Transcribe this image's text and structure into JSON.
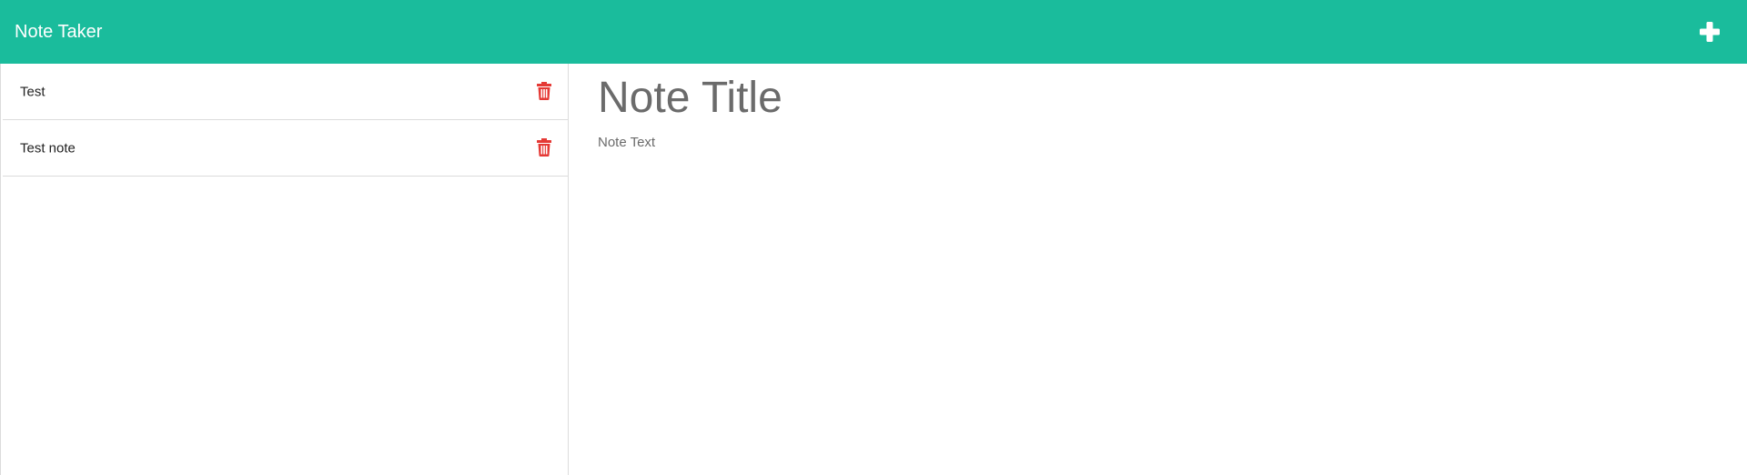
{
  "navbar": {
    "brand": "Note Taker",
    "new_note_icon": "plus-icon",
    "background_color": "#1abc9c"
  },
  "notes": [
    {
      "title": "Test",
      "delete_icon": "trash-icon"
    },
    {
      "title": "Test note",
      "delete_icon": "trash-icon"
    }
  ],
  "editor": {
    "title_placeholder": "Note Title",
    "text_placeholder": "Note Text"
  },
  "colors": {
    "accent": "#1abc9c",
    "delete": "#e53935",
    "placeholder": "#6b6b6b"
  }
}
